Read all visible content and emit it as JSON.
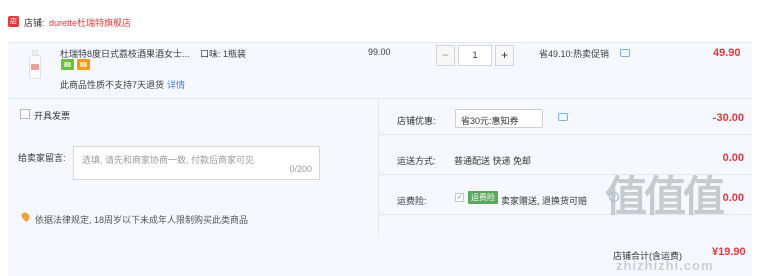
{
  "shop": {
    "label": "店铺:",
    "name": "durette杜瑞特旗舰店"
  },
  "item": {
    "title": "杜瑞特8度日式荔枝酒果酒女士...",
    "spec": "口味: 1瓶装",
    "no_return_note": "此商品性质不支持7天退货",
    "detail_link": "详情",
    "unit_price": "99.00",
    "quantity": "1",
    "qty_minus": "−",
    "qty_plus": "+",
    "saving": "省49.10:热卖促销",
    "total": "49.90"
  },
  "order": {
    "invoice_label": "开具发票",
    "message_label": "给卖家留言:",
    "message_placeholder": "选填, 请先和商家协商一致, 付款后商家可见",
    "message_count": "0/200",
    "law_note": "依据法律规定, 18周岁以下未成年人限制购买此类商品",
    "shop_discount_label": "店铺优惠:",
    "shop_discount_select": "省30元:惠知券",
    "shop_discount_amount": "-30.00",
    "shipping_label": "运送方式:",
    "shipping_value": "普通配送 快递 免邮",
    "shipping_amount": "0.00",
    "insurance_label": "运费险:",
    "insurance_tag": "运费险",
    "insurance_desc": "卖家赠送, 退换货可赔",
    "insurance_amount": "0.00",
    "total_label": "店铺合计(含运费)",
    "total_value": "¥19.90"
  },
  "watermark": {
    "text": "值值值",
    "url": "zhizhizhi.com"
  },
  "colors": {
    "accent_red": "#e4393c",
    "link_blue": "#3c7fd9",
    "panel_bg": "#f5f9ff"
  }
}
